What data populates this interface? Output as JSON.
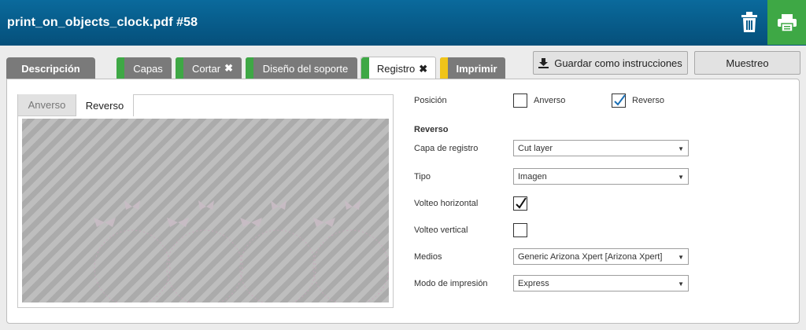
{
  "header": {
    "title": "print_on_objects_clock.pdf #58",
    "delete_icon": "trash-icon",
    "print_icon": "printer-icon",
    "print_bg": "#3ea845"
  },
  "tabs": [
    {
      "label": "Descripción",
      "stripe": ""
    },
    {
      "label": "Capas",
      "stripe": "#3ea845"
    },
    {
      "label": "Cortar",
      "stripe": "#3ea845",
      "close": "✖"
    },
    {
      "label": "Diseño del soporte",
      "stripe": "#3ea845"
    },
    {
      "label": "Registro",
      "stripe": "#3ea845",
      "close": "✖",
      "active": true
    },
    {
      "label": "Imprimir",
      "stripe": "#f0c419"
    }
  ],
  "toolbar": {
    "save_label": "Guardar como instrucciones",
    "save_icon": "download-icon",
    "sample_label": "Muestreo"
  },
  "preview": {
    "tab_front": "Anverso",
    "tab_back": "Reverso",
    "active_tab": "Reverso"
  },
  "form": {
    "position_label": "Posición",
    "front_option": "Anverso",
    "front_checked": false,
    "back_option": "Reverso",
    "back_checked": true,
    "section_title": "Reverso",
    "registration_layer_label": "Capa de registro",
    "registration_layer_value": "Cut layer",
    "type_label": "Tipo",
    "type_value": "Imagen",
    "flip_h_label": "Volteo horizontal",
    "flip_h_checked": true,
    "flip_v_label": "Volteo vertical",
    "flip_v_checked": false,
    "media_label": "Medios",
    "media_value": "Generic Arizona Xpert [Arizona Xpert]",
    "print_mode_label": "Modo de impresión",
    "print_mode_value": "Express"
  },
  "colors": {
    "header_blue": "#0a6a9c",
    "check_blue": "#1a6fb5",
    "tab_gray": "#7a7a7a"
  }
}
